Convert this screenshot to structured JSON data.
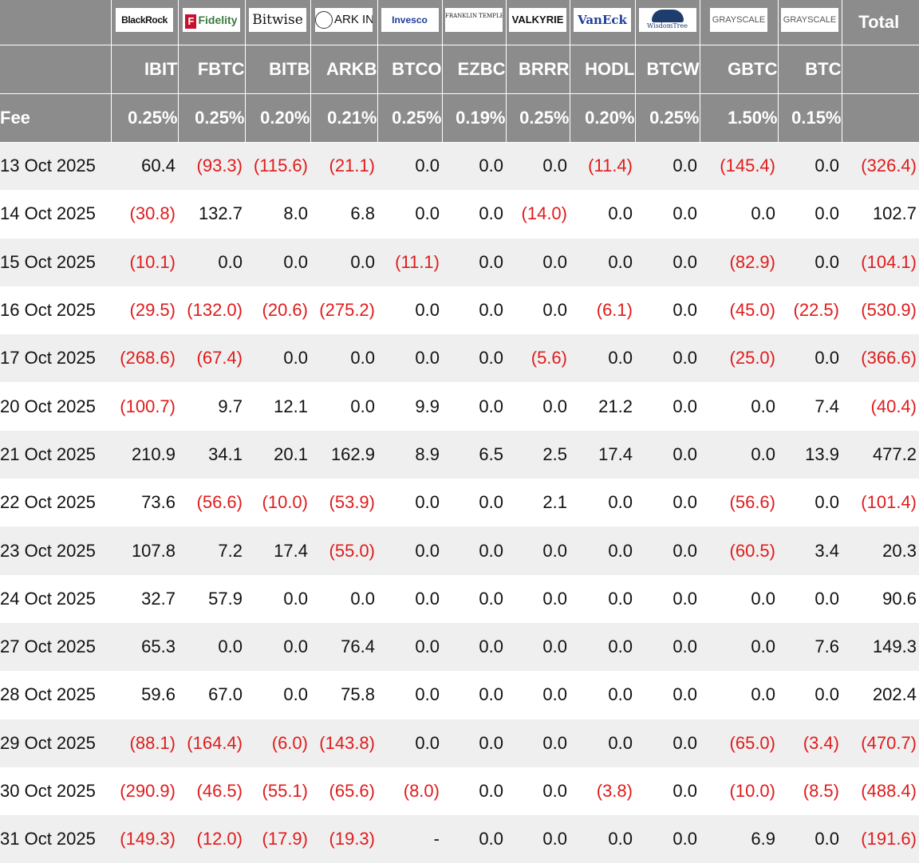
{
  "header": {
    "total_label": "Total",
    "fee_label": "Fee",
    "issuers": [
      {
        "logo_text": "BlackRock",
        "ticker": "IBIT",
        "fee": "0.25%"
      },
      {
        "logo_text": "Fidelity",
        "ticker": "FBTC",
        "fee": "0.25%"
      },
      {
        "logo_text": "Bitwise",
        "ticker": "BITB",
        "fee": "0.20%"
      },
      {
        "logo_text": "ARK INVEST",
        "ticker": "ARKB",
        "fee": "0.21%"
      },
      {
        "logo_text": "Invesco",
        "ticker": "BTCO",
        "fee": "0.25%"
      },
      {
        "logo_text": "FRANKLIN TEMPLETON",
        "ticker": "EZBC",
        "fee": "0.19%"
      },
      {
        "logo_text": "VALKYRIE",
        "ticker": "BRRR",
        "fee": "0.25%"
      },
      {
        "logo_text": "VanEck",
        "ticker": "HODL",
        "fee": "0.20%"
      },
      {
        "logo_text": "WisdomTree",
        "ticker": "BTCW",
        "fee": "0.25%"
      },
      {
        "logo_text": "GRAYSCALE",
        "ticker": "GBTC",
        "fee": "1.50%"
      },
      {
        "logo_text": "GRAYSCALE",
        "ticker": "BTC",
        "fee": "0.15%"
      }
    ]
  },
  "rows": [
    {
      "date": "13 Oct 2025",
      "values": [
        "60.4",
        "(93.3)",
        "(115.6)",
        "(21.1)",
        "0.0",
        "0.0",
        "0.0",
        "(11.4)",
        "0.0",
        "(145.4)",
        "0.0",
        "(326.4)"
      ]
    },
    {
      "date": "14 Oct 2025",
      "values": [
        "(30.8)",
        "132.7",
        "8.0",
        "6.8",
        "0.0",
        "0.0",
        "(14.0)",
        "0.0",
        "0.0",
        "0.0",
        "0.0",
        "102.7"
      ]
    },
    {
      "date": "15 Oct 2025",
      "values": [
        "(10.1)",
        "0.0",
        "0.0",
        "0.0",
        "(11.1)",
        "0.0",
        "0.0",
        "0.0",
        "0.0",
        "(82.9)",
        "0.0",
        "(104.1)"
      ]
    },
    {
      "date": "16 Oct 2025",
      "values": [
        "(29.5)",
        "(132.0)",
        "(20.6)",
        "(275.2)",
        "0.0",
        "0.0",
        "0.0",
        "(6.1)",
        "0.0",
        "(45.0)",
        "(22.5)",
        "(530.9)"
      ]
    },
    {
      "date": "17 Oct 2025",
      "values": [
        "(268.6)",
        "(67.4)",
        "0.0",
        "0.0",
        "0.0",
        "0.0",
        "(5.6)",
        "0.0",
        "0.0",
        "(25.0)",
        "0.0",
        "(366.6)"
      ]
    },
    {
      "date": "20 Oct 2025",
      "values": [
        "(100.7)",
        "9.7",
        "12.1",
        "0.0",
        "9.9",
        "0.0",
        "0.0",
        "21.2",
        "0.0",
        "0.0",
        "7.4",
        "(40.4)"
      ]
    },
    {
      "date": "21 Oct 2025",
      "values": [
        "210.9",
        "34.1",
        "20.1",
        "162.9",
        "8.9",
        "6.5",
        "2.5",
        "17.4",
        "0.0",
        "0.0",
        "13.9",
        "477.2"
      ]
    },
    {
      "date": "22 Oct 2025",
      "values": [
        "73.6",
        "(56.6)",
        "(10.0)",
        "(53.9)",
        "0.0",
        "0.0",
        "2.1",
        "0.0",
        "0.0",
        "(56.6)",
        "0.0",
        "(101.4)"
      ]
    },
    {
      "date": "23 Oct 2025",
      "values": [
        "107.8",
        "7.2",
        "17.4",
        "(55.0)",
        "0.0",
        "0.0",
        "0.0",
        "0.0",
        "0.0",
        "(60.5)",
        "3.4",
        "20.3"
      ]
    },
    {
      "date": "24 Oct 2025",
      "values": [
        "32.7",
        "57.9",
        "0.0",
        "0.0",
        "0.0",
        "0.0",
        "0.0",
        "0.0",
        "0.0",
        "0.0",
        "0.0",
        "90.6"
      ]
    },
    {
      "date": "27 Oct 2025",
      "values": [
        "65.3",
        "0.0",
        "0.0",
        "76.4",
        "0.0",
        "0.0",
        "0.0",
        "0.0",
        "0.0",
        "0.0",
        "7.6",
        "149.3"
      ]
    },
    {
      "date": "28 Oct 2025",
      "values": [
        "59.6",
        "67.0",
        "0.0",
        "75.8",
        "0.0",
        "0.0",
        "0.0",
        "0.0",
        "0.0",
        "0.0",
        "0.0",
        "202.4"
      ]
    },
    {
      "date": "29 Oct 2025",
      "values": [
        "(88.1)",
        "(164.4)",
        "(6.0)",
        "(143.8)",
        "0.0",
        "0.0",
        "0.0",
        "0.0",
        "0.0",
        "(65.0)",
        "(3.4)",
        "(470.7)"
      ]
    },
    {
      "date": "30 Oct 2025",
      "values": [
        "(290.9)",
        "(46.5)",
        "(55.1)",
        "(65.6)",
        "(8.0)",
        "0.0",
        "0.0",
        "(3.8)",
        "0.0",
        "(10.0)",
        "(8.5)",
        "(488.4)"
      ]
    },
    {
      "date": "31 Oct 2025",
      "values": [
        "(149.3)",
        "(12.0)",
        "(17.9)",
        "(19.3)",
        "-",
        "0.0",
        "0.0",
        "0.0",
        "0.0",
        "6.9",
        "0.0",
        "(191.6)"
      ]
    }
  ],
  "colors": {
    "header_bg": "#8c8c8c",
    "negative": "#e01b1b",
    "row_alt": "#efefef"
  }
}
